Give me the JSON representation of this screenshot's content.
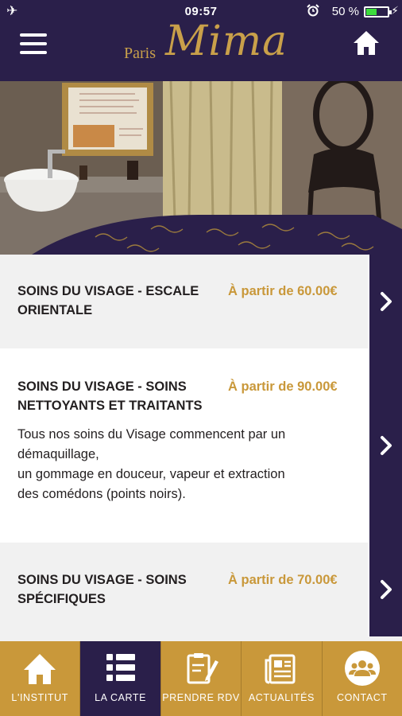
{
  "status_bar": {
    "time": "09:57",
    "battery_percent": "50 %",
    "battery_level": 0.5,
    "icons": [
      "airplane-icon",
      "alarm-icon",
      "battery-icon",
      "charging-bolt-icon"
    ]
  },
  "header": {
    "logo_small": "Paris",
    "logo_large": "Mima",
    "menu_icon": "hamburger-menu-icon",
    "home_icon": "home-icon"
  },
  "items": [
    {
      "title": "SOINS DU VISAGE - ESCALE ORIENTALE",
      "price": "À partir de 60.00€",
      "description": ""
    },
    {
      "title": "SOINS DU VISAGE - SOINS NETTOYANTS ET TRAITANTS",
      "price": "À partir de 90.00€",
      "description_lines": [
        "Tous nos soins du Visage commencent par un",
        "démaquillage,",
        "un gommage en douceur, vapeur et extraction",
        "des comédons (points noirs)."
      ]
    },
    {
      "title": "SOINS DU VISAGE - SOINS SPÉCIFIQUES",
      "price": "À partir de 70.00€",
      "description": ""
    }
  ],
  "nav": {
    "tabs": [
      {
        "label": "L'INSTITUT",
        "icon": "house-icon",
        "active": false
      },
      {
        "label": "LA CARTE",
        "icon": "list-icon",
        "active": true
      },
      {
        "label": "PRENDRE RDV",
        "icon": "clipboard-pen-icon",
        "active": false
      },
      {
        "label": "ACTUALITÉS",
        "icon": "newspaper-icon",
        "active": false
      },
      {
        "label": "CONTACT",
        "icon": "group-icon",
        "active": false
      }
    ]
  },
  "colors": {
    "brand_dark": "#2a1f4a",
    "gold": "#c9983a",
    "light_gray": "#f1f1f1"
  }
}
